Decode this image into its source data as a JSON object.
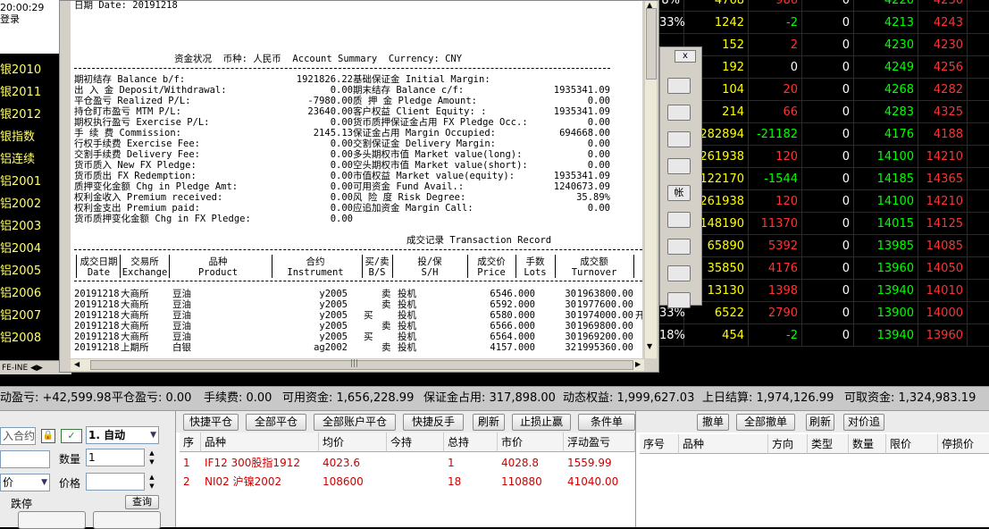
{
  "left": {
    "time": "20:00:29",
    "login": "登录",
    "rows": [
      "银2010",
      "银2011",
      "银2012",
      "银指数",
      "铝连续",
      "铝2001",
      "铝2002",
      "铝2003",
      "铝2004",
      "铝2005",
      "铝2006",
      "铝2007",
      "铝2008"
    ],
    "tab": "FE-INE"
  },
  "grid": {
    "rows": [
      {
        "a": "8%",
        "b": "4768",
        "c": "986",
        "d": "0",
        "e": "4220",
        "f": "4230"
      },
      {
        "a": "33%",
        "b": "1242",
        "c": "-2",
        "d": "0",
        "e": "4213",
        "f": "4243"
      },
      {
        "a": "",
        "b": "152",
        "c": "2",
        "d": "0",
        "e": "4230",
        "f": "4230"
      },
      {
        "a": "",
        "b": "192",
        "c": "0",
        "d": "0",
        "e": "4249",
        "f": "4256"
      },
      {
        "a": "",
        "b": "104",
        "c": "20",
        "d": "0",
        "e": "4268",
        "f": "4282"
      },
      {
        "a": "",
        "b": "214",
        "c": "66",
        "d": "0",
        "e": "4283",
        "f": "4325"
      },
      {
        "a": "",
        "b": "282894",
        "c": "-21182",
        "d": "0",
        "e": "4176",
        "f": "4188"
      },
      {
        "a": "",
        "b": "261938",
        "c": "120",
        "d": "0",
        "e": "14100",
        "f": "14210"
      },
      {
        "a": "",
        "b": "122170",
        "c": "-1544",
        "d": "0",
        "e": "14185",
        "f": "14365"
      },
      {
        "a": "",
        "b": "261938",
        "c": "120",
        "d": "0",
        "e": "14100",
        "f": "14210"
      },
      {
        "a": "",
        "b": "148190",
        "c": "11370",
        "d": "0",
        "e": "14015",
        "f": "14125"
      },
      {
        "a": "",
        "b": "65890",
        "c": "5392",
        "d": "0",
        "e": "13985",
        "f": "14085"
      },
      {
        "a": "",
        "b": "35850",
        "c": "4176",
        "d": "0",
        "e": "13960",
        "f": "14050"
      },
      {
        "a": "",
        "b": "13130",
        "c": "1398",
        "d": "0",
        "e": "13940",
        "f": "14010"
      },
      {
        "a": "33%",
        "b": "6522",
        "c": "2790",
        "d": "0",
        "e": "13900",
        "f": "14000"
      },
      {
        "a": "18%",
        "b": "454",
        "c": "-2",
        "d": "0",
        "e": "13940",
        "f": "13960"
      }
    ]
  },
  "dialog": {
    "close": "x",
    "buttons": [
      "",
      "",
      "",
      "",
      "帐",
      "",
      "",
      "",
      ""
    ]
  },
  "stmt": {
    "date_line": "日期 Date: 20191218",
    "header": "资金状况  币种: 人民币  Account Summary  Currency: CNY",
    "rows": [
      [
        "期初结存 Balance b/f:",
        "1921826.22",
        "基础保证金 Initial Margin:",
        ""
      ],
      [
        "出 入 金 Deposit/Withdrawal:",
        "0.00",
        "期末结存 Balance c/f:",
        "1935341.09"
      ],
      [
        "平仓盈亏 Realized P/L:",
        "-7980.00",
        "质 押 金 Pledge Amount:",
        "0.00"
      ],
      [
        "持仓盯市盈亏 MTM P/L:",
        "23640.00",
        "客户权益 Client Equity: :",
        "1935341.09"
      ],
      [
        "期权执行盈亏 Exercise P/L:",
        "0.00",
        "货币质押保证金占用 FX Pledge Occ.:",
        "0.00"
      ],
      [
        "手 续 费 Commission:",
        "2145.13",
        "保证金占用 Margin Occupied:",
        "694668.00"
      ],
      [
        "行权手续费 Exercise Fee:",
        "0.00",
        "交割保证金 Delivery Margin:",
        "0.00"
      ],
      [
        "交割手续费 Delivery Fee:",
        "0.00",
        "多头期权市值 Market value(long):",
        "0.00"
      ],
      [
        "货币质入 New FX Pledge:",
        "0.00",
        "空头期权市值 Market value(short):",
        "0.00"
      ],
      [
        "货币质出 FX Redemption:",
        "0.00",
        "市值权益 Market value(equity):",
        "1935341.09"
      ],
      [
        "质押变化金额 Chg in Pledge Amt:",
        "0.00",
        "可用资金 Fund Avail.:",
        "1240673.09"
      ],
      [
        "权利金收入 Premium received:",
        "0.00",
        "风 险 度 Risk Degree:",
        "35.89%"
      ],
      [
        "权利金支出 Premium paid:",
        "0.00",
        "应追加资金 Margin Call:",
        "0.00"
      ],
      [
        "货币质押变化金额 Chg in FX Pledge:",
        "0.00",
        "",
        ""
      ]
    ],
    "tx_title": "成交记录 Transaction Record",
    "tx_headers": [
      [
        "成交日期",
        "Date"
      ],
      [
        "交易所",
        "Exchange"
      ],
      [
        "品种",
        "Product"
      ],
      [
        "合约",
        "Instrument"
      ],
      [
        "买/卖",
        "B/S"
      ],
      [
        "投/保",
        "S/H"
      ],
      [
        "成交价",
        "Price"
      ],
      [
        "手数",
        "Lots"
      ],
      [
        "成交额",
        "Turnover"
      ]
    ],
    "tx_rows": [
      [
        "20191218",
        "大商所",
        "豆油",
        "y2005",
        "",
        "卖",
        "投机",
        "6546.000",
        "30",
        "1963800.00"
      ],
      [
        "20191218",
        "大商所",
        "豆油",
        "y2005",
        "",
        "卖",
        "投机",
        "6592.000",
        "30",
        "1977600.00"
      ],
      [
        "20191218",
        "大商所",
        "豆油",
        "y2005",
        "买",
        "",
        "投机",
        "6580.000",
        "30",
        "1974000.00"
      ],
      [
        "20191218",
        "大商所",
        "豆油",
        "y2005",
        "",
        "卖",
        "投机",
        "6566.000",
        "30",
        "1969800.00"
      ],
      [
        "20191218",
        "大商所",
        "豆油",
        "y2005",
        "买",
        "",
        "投机",
        "6564.000",
        "30",
        "1969200.00"
      ],
      [
        "20191218",
        "上期所",
        "白银",
        "ag2002",
        "",
        "卖",
        "投机",
        "4157.000",
        "32",
        "1995360.00"
      ]
    ],
    "overflow_mark": "开"
  },
  "status": {
    "items": [
      "动盈亏: +42,599.98",
      "平仓盈亏: 0.00",
      "手续费: 0.00",
      "可用资金: 1,656,228.99",
      "保证金占用: 317,898.00",
      "动态权益: 1,999,627.03",
      "上日结算: 1,974,126.99",
      "可取资金: 1,324,983.19"
    ]
  },
  "order": {
    "contract_placeholder": "入合约",
    "lock": "🔒",
    "mode": "1. 自动",
    "qty_label": "数量",
    "qty": "1",
    "price_label": "价格",
    "price_type": "价",
    "limit_down": "跌停",
    "query": "查询"
  },
  "positions": {
    "buttons": [
      "快捷平仓",
      "全部平仓",
      "全部账户平仓",
      "快捷反手",
      "刷新",
      "止损止赢",
      "条件单"
    ],
    "headers": [
      "序",
      "品种",
      "均价",
      "今持",
      "总持",
      "市价",
      "浮动盈亏"
    ],
    "rows": [
      [
        "1",
        "IF12 300股指1912",
        "4023.6",
        "",
        "1",
        "4028.8",
        "1559.99"
      ],
      [
        "2",
        "NI02 沪镍2002",
        "108600",
        "",
        "18",
        "110880",
        "41040.00"
      ]
    ]
  },
  "orders": {
    "buttons": [
      "撤单",
      "全部撤单",
      "刷新",
      "对价追"
    ],
    "headers": [
      "序号",
      "品种",
      "方向",
      "类型",
      "数量",
      "限价",
      "停损价"
    ]
  }
}
